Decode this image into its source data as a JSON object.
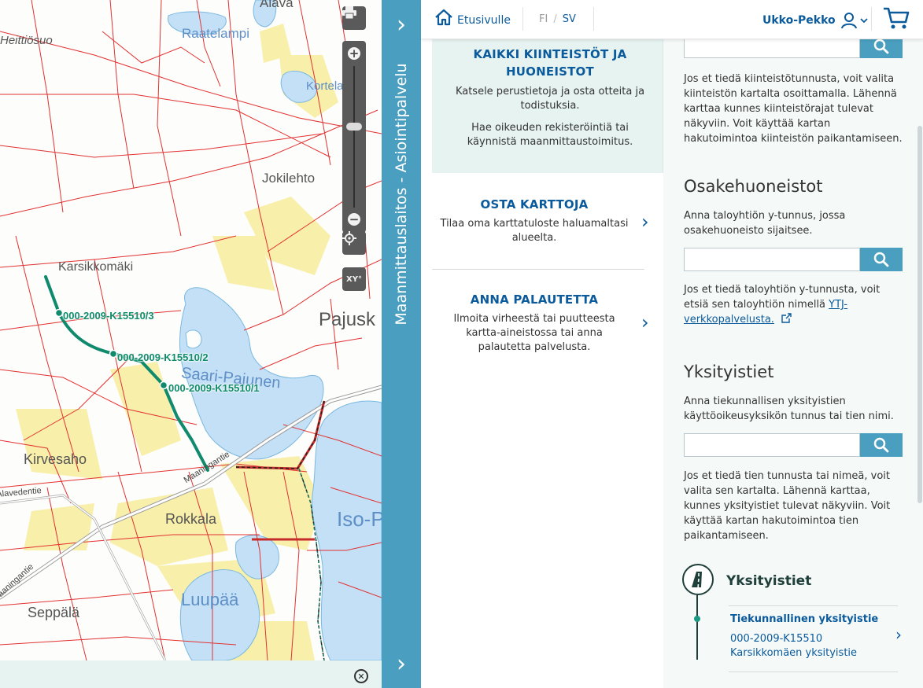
{
  "map": {
    "place_names": [
      "Alava",
      "Heittiösuo",
      "Jokilehto",
      "Karsikkomäki",
      "Pajusk",
      "Kirvesaho",
      "Rokkala",
      "Seppälä"
    ],
    "water_names": [
      "Raatelampi",
      "Kortela",
      "Saari-Pajunen",
      "Iso-P",
      "Luupää"
    ],
    "road_names": [
      "Maaningantie",
      "Alavedentie",
      "Maaningantie"
    ],
    "segment_labels": [
      "000-2009-K15510/3",
      "000-2009-K15510/2",
      "000-2009-K15510/1"
    ],
    "controls": {
      "print_icon": "printer-icon",
      "zoom_in_icon": "plus-circle-icon",
      "zoom_out_icon": "minus-circle-icon",
      "locate_icon": "crosshair-icon",
      "coords_label": "XY°",
      "zoom_level_fraction": 0.4
    },
    "close_icon": "close-circle-icon"
  },
  "sidebar_bar": {
    "title": "Maanmittauslaitos - Asiointipalvelu",
    "top_chevron": "›",
    "bottom_chevron": "›"
  },
  "header": {
    "home_label": "Etusivulle",
    "lang_fi": "FI",
    "lang_sv": "SV",
    "user_name": "Ukko-Pekko",
    "cart_icon": "cart-icon"
  },
  "menu": {
    "kiinteistot": {
      "title": "KAIKKI KIINTEISTÖT JA HUONEISTOT",
      "text1": "Katsele perustietoja ja osta otteita ja todistuksia.",
      "text2": "Hae oikeuden rekisteröintiä tai käynnistä maanmittaustoimitus."
    },
    "osta_karttoja": {
      "title": "OSTA KARTTOJA",
      "text": "Tilaa oma karttatuloste haluamaltasi alueelta.",
      "chevron": "›"
    },
    "anna_palautetta": {
      "title": "ANNA PALAUTETTA",
      "text": "Ilmoita virheestä tai puutteesta kartta-aineistossa tai anna palautetta palvelusta.",
      "chevron": "›"
    }
  },
  "panel": {
    "kiint_search_value": "",
    "kiint_help": "Jos et tiedä kiinteistötunnusta, voit valita kiinteistön kartalta osoittamalla. Lähennä karttaa kunnes kiinteistörajat tulevat näkyviin. Voit käyttää kartan hakutoimintoa kiinteistön paikantamiseen.",
    "osake_title": "Osakehuoneistot",
    "osake_prompt": "Anna taloyhtiön y-tunnus, jossa osakehuoneisto sijaitsee.",
    "osake_search_value": "",
    "osake_help_pre": "Jos et tiedä taloyhtiön y-tunnusta, voit etsiä sen taloyhtiön nimellä ",
    "osake_help_link": "YTJ-verkkopalvelusta.",
    "yksi_title": "Yksityistiet",
    "yksi_prompt": "Anna tiekunnallisen yksityistien käyttöoikeusyksikön tunnus tai tien nimi.",
    "yksi_search_value": "",
    "yksi_help": "Jos et tiedä tien tunnusta tai nimeä, voit valita sen kartalta. Lähennä karttaa, kunnes yksityistiet tulevat näkyviin. Voit käyttää kartan hakutoimintoa tien paikantamiseen.",
    "result_heading": "Yksityistiet",
    "result_type": "Tiekunnallinen yksityistie",
    "result_name": "000-2009-K15510 Karsikkomäen yksityistie",
    "search_icon": "search-icon"
  },
  "colors": {
    "accent_blue": "#4a9ebf",
    "link_blue": "#0a5a9c",
    "route_green": "#0f8c6a",
    "panel_bg": "#e7f3f1"
  }
}
